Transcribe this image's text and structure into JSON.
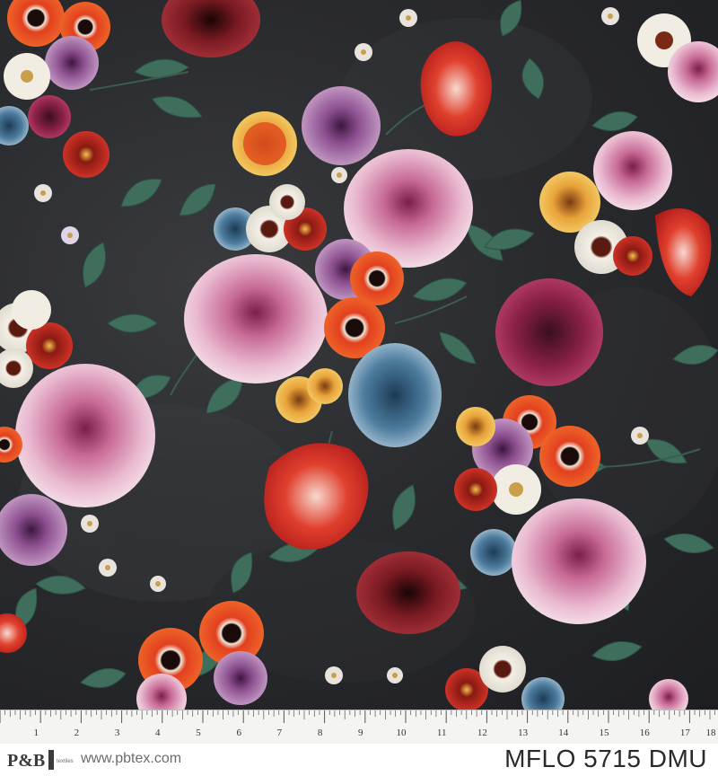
{
  "fabric": {
    "background_color": "#26272a",
    "motif": "floral"
  },
  "ruler": {
    "numbers": [
      "1",
      "2",
      "3",
      "4",
      "5",
      "6",
      "7",
      "8",
      "9",
      "10",
      "11",
      "12",
      "13",
      "14",
      "15",
      "16",
      "17",
      "18"
    ]
  },
  "footer": {
    "brand_logo": "P&B",
    "brand_subtext": "textiles",
    "website": "www.pbtex.com",
    "product_code": "MFLO 5715 DMU"
  }
}
